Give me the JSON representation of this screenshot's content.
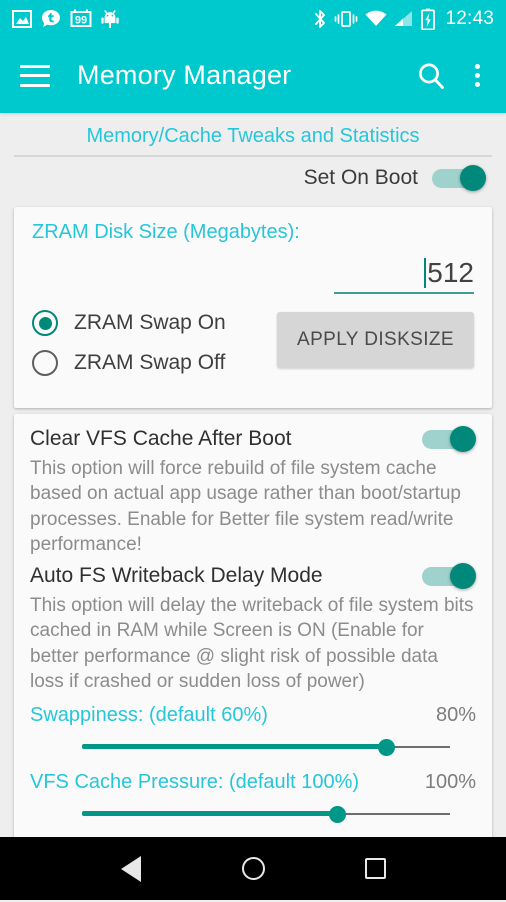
{
  "statusbar": {
    "left_icons": [
      "image-icon",
      "tumblr-chat-icon",
      "99-badge-icon",
      "android-bug-icon"
    ],
    "right_icons": [
      "bluetooth-icon",
      "vibrate-icon",
      "wifi-icon",
      "signal-icon",
      "battery-charging-icon"
    ],
    "badge_text": "99",
    "clock": "12:43",
    "background": "#00c9ce"
  },
  "appbar": {
    "menu_icon": "hamburger-menu-icon",
    "title": "Memory Manager",
    "search_icon": "search-icon",
    "overflow_icon": "overflow-menu-icon",
    "background": "#00c9ce"
  },
  "section": {
    "title": "Memory/Cache Tweaks and Statistics",
    "accent_color": "#26c6da"
  },
  "set_on_boot": {
    "label": "Set On Boot",
    "enabled": true
  },
  "zram_card": {
    "label": "ZRAM Disk Size (Megabytes):",
    "disk_size_value": "512",
    "disk_size_placeholder": "512",
    "radio_options": [
      {
        "label": "ZRAM Swap On",
        "selected": true
      },
      {
        "label": "ZRAM Swap Off",
        "selected": false
      }
    ],
    "apply_button": "APPLY DISKSIZE"
  },
  "options_card": {
    "items": [
      {
        "title": "Clear VFS Cache After Boot",
        "description": "This option will force rebuild of file system cache based on actual app usage rather than boot/startup processes. Enable for Better file system read/write performance!",
        "enabled": true
      },
      {
        "title": "Auto FS Writeback Delay Mode",
        "description": "This option will delay the writeback of file system bits cached in RAM while Screen is ON (Enable for better performance @ slight risk of possible data loss if crashed or sudden loss of power)",
        "enabled": true
      }
    ],
    "sliders": [
      {
        "name": "Swappiness: (default 60%)",
        "value_label": "80%",
        "percent": 80
      },
      {
        "name": "VFS Cache Pressure: (default 100%)",
        "value_label": "100%",
        "percent": 67
      }
    ]
  },
  "navbar": {
    "back": "back-button",
    "home": "home-button",
    "recents": "recents-button"
  },
  "colors": {
    "primary": "#00c9ce",
    "accent": "#26c6da",
    "toggle_on": "#00897b",
    "slider": "#009688",
    "page_bg": "#eeeeee",
    "card_bg": "#fafafa"
  }
}
